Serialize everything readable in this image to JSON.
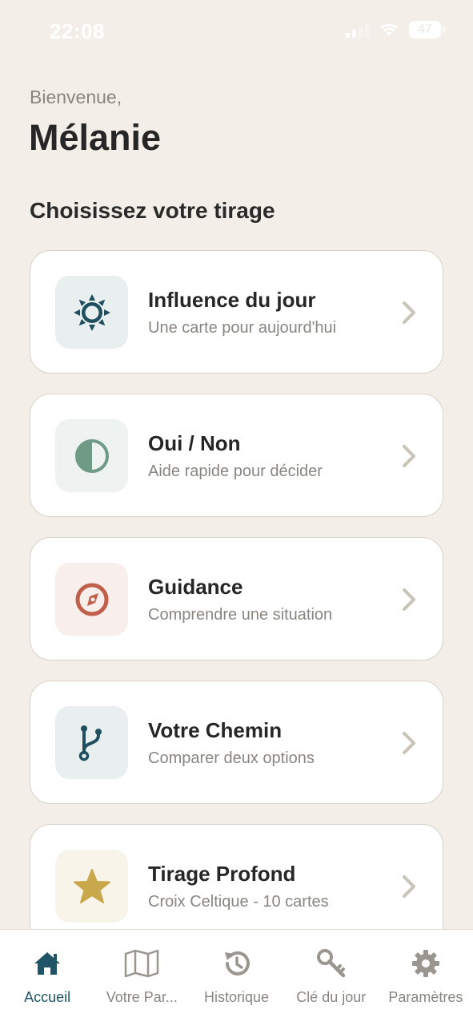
{
  "status": {
    "time": "22:08",
    "battery": "47"
  },
  "header": {
    "greeting": "Bienvenue,",
    "name": "Mélanie"
  },
  "section": {
    "title": "Choisissez votre tirage"
  },
  "cards": [
    {
      "title": "Influence du jour",
      "subtitle": "Une carte pour aujourd'hui",
      "icon": "sun-icon",
      "icon_color": "#1f4f5f",
      "icon_bg": "#e9eeee"
    },
    {
      "title": "Oui / Non",
      "subtitle": "Aide rapide pour décider",
      "icon": "half-circle-icon",
      "icon_color": "#6f9a86",
      "icon_bg": "#eef2f0"
    },
    {
      "title": "Guidance",
      "subtitle": "Comprendre une situation",
      "icon": "compass-icon",
      "icon_color": "#c0604a",
      "icon_bg": "#f8eeec"
    },
    {
      "title": "Votre Chemin",
      "subtitle": "Comparer deux options",
      "icon": "branch-icon",
      "icon_color": "#1f4f5f",
      "icon_bg": "#e9eeee"
    },
    {
      "title": "Tirage Profond",
      "subtitle": "Croix Celtique - 10 cartes",
      "icon": "star-icon",
      "icon_color": "#c9a84c",
      "icon_bg": "#f8f4ea"
    }
  ],
  "tabs": [
    {
      "label": "Accueil",
      "icon": "home-icon",
      "active": true
    },
    {
      "label": "Votre Par...",
      "icon": "map-icon",
      "active": false
    },
    {
      "label": "Historique",
      "icon": "history-icon",
      "active": false
    },
    {
      "label": "Clé du jour",
      "icon": "key-icon",
      "active": false
    },
    {
      "label": "Paramètres",
      "icon": "gear-icon",
      "active": false
    }
  ],
  "colors": {
    "accent": "#1f5566",
    "background": "#f3efe8",
    "muted": "#8a8580"
  }
}
